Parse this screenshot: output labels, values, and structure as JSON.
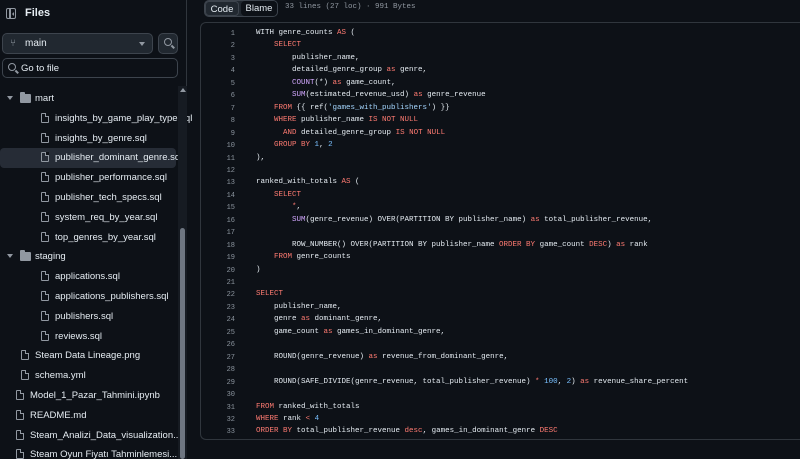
{
  "sidebar": {
    "title": "Files",
    "branch": "main",
    "goto_placeholder": "Go to file",
    "tree": [
      {
        "label": "mart",
        "type": "folder",
        "depth": 0
      },
      {
        "label": "insights_by_game_play_type.sql",
        "type": "file",
        "depth": 1
      },
      {
        "label": "insights_by_genre.sql",
        "type": "file",
        "depth": 1
      },
      {
        "label": "publisher_dominant_genre.sql",
        "type": "file",
        "depth": 1,
        "selected": true
      },
      {
        "label": "publisher_performance.sql",
        "type": "file",
        "depth": 1
      },
      {
        "label": "publisher_tech_specs.sql",
        "type": "file",
        "depth": 1
      },
      {
        "label": "system_req_by_year.sql",
        "type": "file",
        "depth": 1
      },
      {
        "label": "top_genres_by_year.sql",
        "type": "file",
        "depth": 1
      },
      {
        "label": "staging",
        "type": "folder",
        "depth": 0
      },
      {
        "label": "applications.sql",
        "type": "file",
        "depth": 1
      },
      {
        "label": "applications_publishers.sql",
        "type": "file",
        "depth": 1
      },
      {
        "label": "publishers.sql",
        "type": "file",
        "depth": 1
      },
      {
        "label": "reviews.sql",
        "type": "file",
        "depth": 1
      },
      {
        "label": "Steam Data Lineage.png",
        "type": "file",
        "depth": 0
      },
      {
        "label": "schema.yml",
        "type": "file",
        "depth": 0
      },
      {
        "label": "Model_1_Pazar_Tahmini.ipynb",
        "type": "file",
        "depth": -1
      },
      {
        "label": "README.md",
        "type": "file",
        "depth": -1
      },
      {
        "label": "Steam_Analizi_Data_visualization...",
        "type": "file",
        "depth": -1
      },
      {
        "label": "Steam Oyun Fiyatı Tahminlemesi...",
        "type": "file",
        "depth": -1
      }
    ]
  },
  "editor": {
    "tabs": [
      {
        "label": "Code"
      },
      {
        "label": "Blame"
      }
    ],
    "active_tab": "Code",
    "meta": "33 lines (27 loc) · 991 Bytes",
    "lines": [
      {
        "n": "1",
        "code": [
          [
            "t",
            "WITH genre_counts "
          ],
          [
            "k",
            "AS"
          ],
          [
            "t",
            " ("
          ]
        ]
      },
      {
        "n": "2",
        "code": [
          [
            "t",
            "    "
          ],
          [
            "k",
            "SELECT"
          ]
        ]
      },
      {
        "n": "3",
        "code": [
          [
            "t",
            "        publisher_name,"
          ]
        ]
      },
      {
        "n": "4",
        "code": [
          [
            "t",
            "        detailed_genre_group "
          ],
          [
            "k",
            "as"
          ],
          [
            "t",
            " genre,"
          ]
        ]
      },
      {
        "n": "5",
        "code": [
          [
            "t",
            "        "
          ],
          [
            "f",
            "COUNT"
          ],
          [
            "t",
            "(*) "
          ],
          [
            "k",
            "as"
          ],
          [
            "t",
            " game_count,"
          ]
        ]
      },
      {
        "n": "6",
        "code": [
          [
            "t",
            "        "
          ],
          [
            "f",
            "SUM"
          ],
          [
            "t",
            "(estimated_revenue_usd) "
          ],
          [
            "k",
            "as"
          ],
          [
            "t",
            " genre_revenue"
          ]
        ]
      },
      {
        "n": "7",
        "code": [
          [
            "t",
            "    "
          ],
          [
            "k",
            "FROM"
          ],
          [
            "t",
            " {{ ref("
          ],
          [
            "s",
            "'games_with_publishers'"
          ],
          [
            "t",
            ") }}"
          ]
        ]
      },
      {
        "n": "8",
        "code": [
          [
            "t",
            "    "
          ],
          [
            "k",
            "WHERE"
          ],
          [
            "t",
            " publisher_name "
          ],
          [
            "k",
            "IS NOT NULL"
          ]
        ]
      },
      {
        "n": "9",
        "code": [
          [
            "t",
            "      "
          ],
          [
            "k",
            "AND"
          ],
          [
            "t",
            " detailed_genre_group "
          ],
          [
            "k",
            "IS NOT NULL"
          ]
        ]
      },
      {
        "n": "10",
        "code": [
          [
            "t",
            "    "
          ],
          [
            "k",
            "GROUP BY"
          ],
          [
            "t",
            " "
          ],
          [
            "n",
            "1"
          ],
          [
            "t",
            ", "
          ],
          [
            "n",
            "2"
          ]
        ]
      },
      {
        "n": "11",
        "code": [
          [
            "t",
            "),"
          ]
        ]
      },
      {
        "n": "12",
        "code": [
          [
            "t",
            ""
          ]
        ]
      },
      {
        "n": "13",
        "code": [
          [
            "t",
            "ranked_with_totals "
          ],
          [
            "k",
            "AS"
          ],
          [
            "t",
            " ("
          ]
        ]
      },
      {
        "n": "14",
        "code": [
          [
            "t",
            "    "
          ],
          [
            "k",
            "SELECT"
          ]
        ]
      },
      {
        "n": "15",
        "code": [
          [
            "t",
            "        "
          ],
          [
            "k",
            "*"
          ],
          [
            "t",
            ","
          ]
        ]
      },
      {
        "n": "16",
        "code": [
          [
            "t",
            "        "
          ],
          [
            "f",
            "SUM"
          ],
          [
            "t",
            "(genre_revenue) OVER(PARTITION BY publisher_name) "
          ],
          [
            "k",
            "as"
          ],
          [
            "t",
            " total_publisher_revenue,"
          ]
        ]
      },
      {
        "n": "17",
        "code": [
          [
            "t",
            ""
          ]
        ]
      },
      {
        "n": "18",
        "code": [
          [
            "t",
            "        ROW_NUMBER() OVER(PARTITION BY publisher_name "
          ],
          [
            "k",
            "ORDER BY"
          ],
          [
            "t",
            " game_count "
          ],
          [
            "k",
            "DESC"
          ],
          [
            "t",
            ") "
          ],
          [
            "k",
            "as"
          ],
          [
            "t",
            " rank"
          ]
        ]
      },
      {
        "n": "19",
        "code": [
          [
            "t",
            "    "
          ],
          [
            "k",
            "FROM"
          ],
          [
            "t",
            " genre_counts"
          ]
        ]
      },
      {
        "n": "20",
        "code": [
          [
            "t",
            ")"
          ]
        ]
      },
      {
        "n": "21",
        "code": [
          [
            "t",
            ""
          ]
        ]
      },
      {
        "n": "22",
        "code": [
          [
            "k",
            "SELECT"
          ]
        ]
      },
      {
        "n": "23",
        "code": [
          [
            "t",
            "    publisher_name,"
          ]
        ]
      },
      {
        "n": "24",
        "code": [
          [
            "t",
            "    genre "
          ],
          [
            "k",
            "as"
          ],
          [
            "t",
            " dominant_genre,"
          ]
        ]
      },
      {
        "n": "25",
        "code": [
          [
            "t",
            "    game_count "
          ],
          [
            "k",
            "as"
          ],
          [
            "t",
            " games_in_dominant_genre,"
          ]
        ]
      },
      {
        "n": "26",
        "code": [
          [
            "t",
            ""
          ]
        ]
      },
      {
        "n": "27",
        "code": [
          [
            "t",
            "    ROUND(genre_revenue) "
          ],
          [
            "k",
            "as"
          ],
          [
            "t",
            " revenue_from_dominant_genre,"
          ]
        ]
      },
      {
        "n": "28",
        "code": [
          [
            "t",
            ""
          ]
        ]
      },
      {
        "n": "29",
        "code": [
          [
            "t",
            "    ROUND(SAFE_DIVIDE(genre_revenue, total_publisher_revenue) "
          ],
          [
            "k",
            "*"
          ],
          [
            "t",
            " "
          ],
          [
            "n",
            "100"
          ],
          [
            "t",
            ", "
          ],
          [
            "n",
            "2"
          ],
          [
            "t",
            ") "
          ],
          [
            "k",
            "as"
          ],
          [
            "t",
            " revenue_share_percent"
          ]
        ]
      },
      {
        "n": "30",
        "code": [
          [
            "t",
            ""
          ]
        ]
      },
      {
        "n": "31",
        "code": [
          [
            "k",
            "FROM"
          ],
          [
            "t",
            " ranked_with_totals"
          ]
        ]
      },
      {
        "n": "32",
        "code": [
          [
            "k",
            "WHERE"
          ],
          [
            "t",
            " rank "
          ],
          [
            "k",
            "<"
          ],
          [
            "t",
            " "
          ],
          [
            "n",
            "4"
          ]
        ]
      },
      {
        "n": "33",
        "code": [
          [
            "k",
            "ORDER BY"
          ],
          [
            "t",
            " total_publisher_revenue "
          ],
          [
            "k",
            "desc"
          ],
          [
            "t",
            ", games_in_dominant_genre "
          ],
          [
            "k",
            "DESC"
          ]
        ]
      }
    ]
  }
}
